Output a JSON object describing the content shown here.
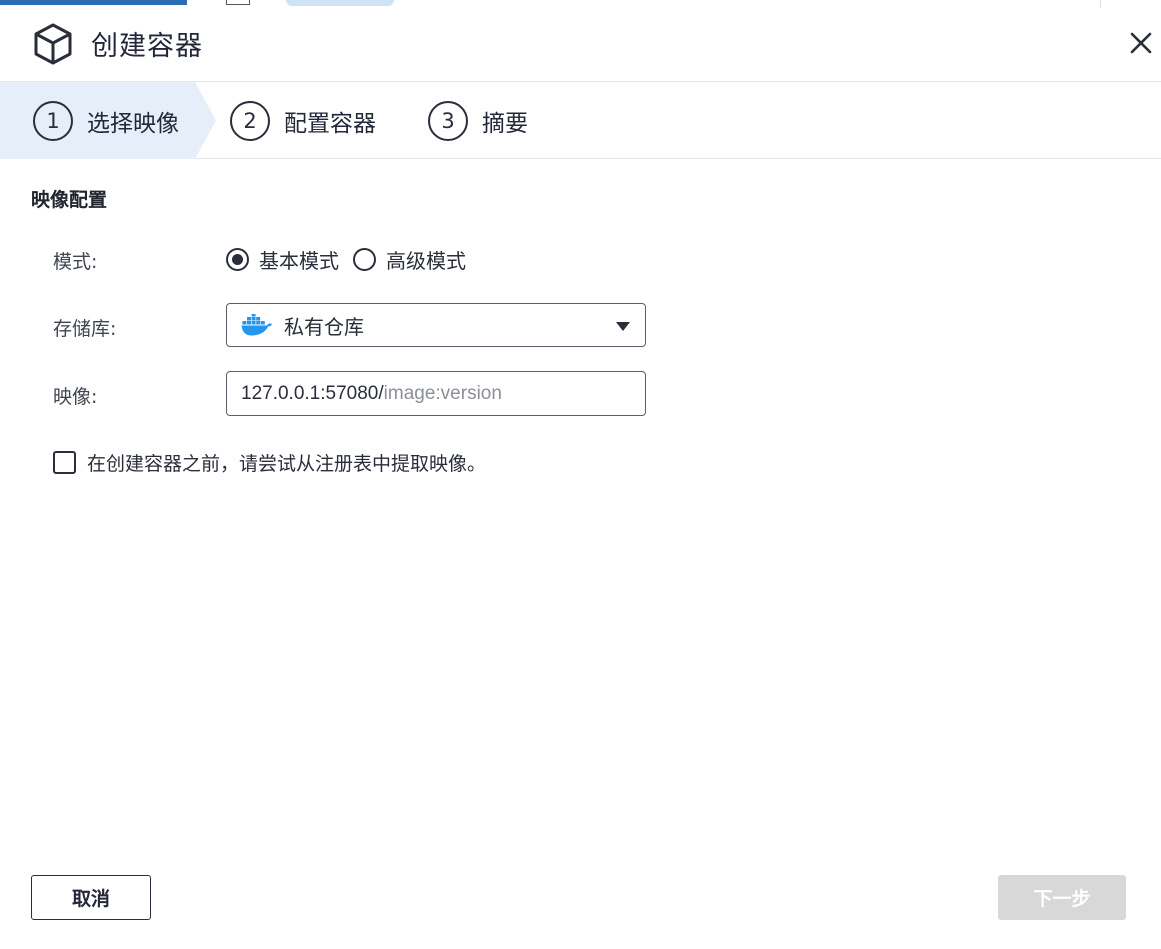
{
  "dialog": {
    "title": "创建容器",
    "title_icon": "cube-icon",
    "close_icon": "close-icon"
  },
  "steps": [
    {
      "number": "1",
      "label": "选择映像",
      "active": true
    },
    {
      "number": "2",
      "label": "配置容器",
      "active": false
    },
    {
      "number": "3",
      "label": "摘要",
      "active": false
    }
  ],
  "section": {
    "title": "映像配置"
  },
  "form": {
    "mode": {
      "label": "模式:",
      "options": [
        {
          "label": "基本模式",
          "selected": true
        },
        {
          "label": "高级模式",
          "selected": false
        }
      ]
    },
    "registry": {
      "label": "存储库:",
      "icon": "docker-icon",
      "selected": "私有仓库"
    },
    "image": {
      "label": "映像:",
      "prefix": "127.0.0.1:57080/",
      "value": "",
      "placeholder": "image:version"
    },
    "pull_checkbox": {
      "label": "在创建容器之前，请尝试从注册表中提取映像。",
      "checked": false
    }
  },
  "footer": {
    "cancel_label": "取消",
    "next_label": "下一步",
    "next_disabled": true
  },
  "colors": {
    "active_step_bg": "#e6eefa",
    "docker_blue": "#2496ed",
    "disabled_button": "#d8d8d8"
  }
}
